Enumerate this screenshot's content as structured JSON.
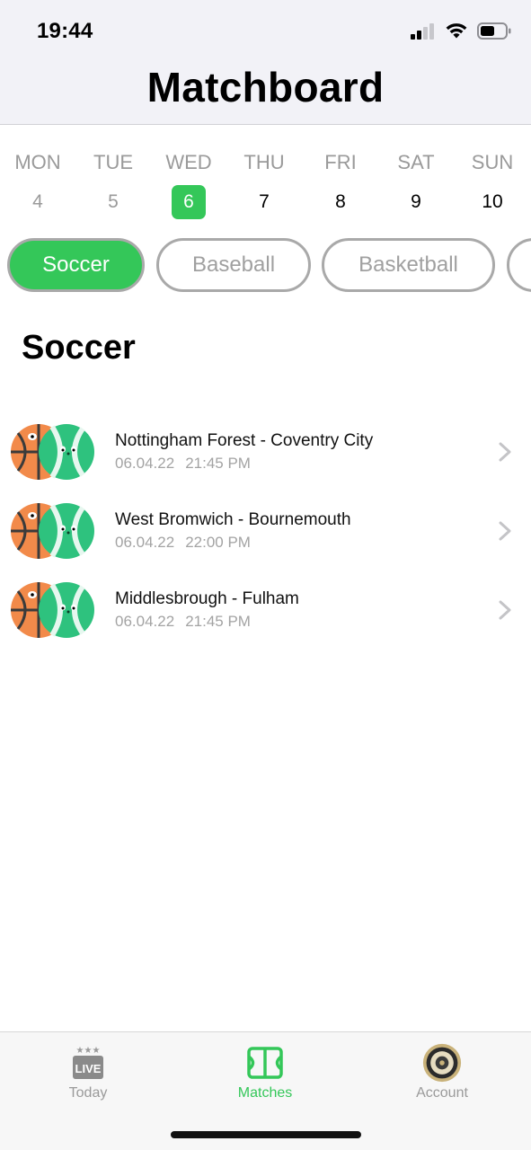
{
  "status_bar": {
    "time": "19:44"
  },
  "header": {
    "title": "Matchboard"
  },
  "week": [
    {
      "day": "MON",
      "date": "4",
      "state": "past"
    },
    {
      "day": "TUE",
      "date": "5",
      "state": "past"
    },
    {
      "day": "WED",
      "date": "6",
      "state": "selected"
    },
    {
      "day": "THU",
      "date": "7",
      "state": "upcoming"
    },
    {
      "day": "FRI",
      "date": "8",
      "state": "upcoming"
    },
    {
      "day": "SAT",
      "date": "9",
      "state": "upcoming"
    },
    {
      "day": "SUN",
      "date": "10",
      "state": "upcoming"
    }
  ],
  "sports": [
    {
      "label": "Soccer",
      "active": true
    },
    {
      "label": "Baseball",
      "active": false
    },
    {
      "label": "Basketball",
      "active": false
    },
    {
      "label": "",
      "active": false
    }
  ],
  "section": {
    "title": "Soccer"
  },
  "matches": [
    {
      "title": "Nottingham Forest - Coventry City",
      "date": "06.04.22",
      "time": "21:45 PM",
      "icon": "basketball-tennis-ball-icon"
    },
    {
      "title": "West Bromwich - Bournemouth",
      "date": "06.04.22",
      "time": "22:00 PM",
      "icon": "basketball-tennis-ball-icon"
    },
    {
      "title": "Middlesbrough - Fulham",
      "date": "06.04.22",
      "time": "21:45 PM",
      "icon": "basketball-tennis-ball-icon"
    }
  ],
  "tabs": [
    {
      "label": "Today",
      "icon": "live-icon",
      "active": false
    },
    {
      "label": "Matches",
      "icon": "court-icon",
      "active": true
    },
    {
      "label": "Account",
      "icon": "avatar",
      "active": false
    }
  ],
  "colors": {
    "accent": "#34c759",
    "muted": "#9a9a9a",
    "chip_border": "#a9a9a9",
    "header_bg": "#f2f2f7"
  }
}
